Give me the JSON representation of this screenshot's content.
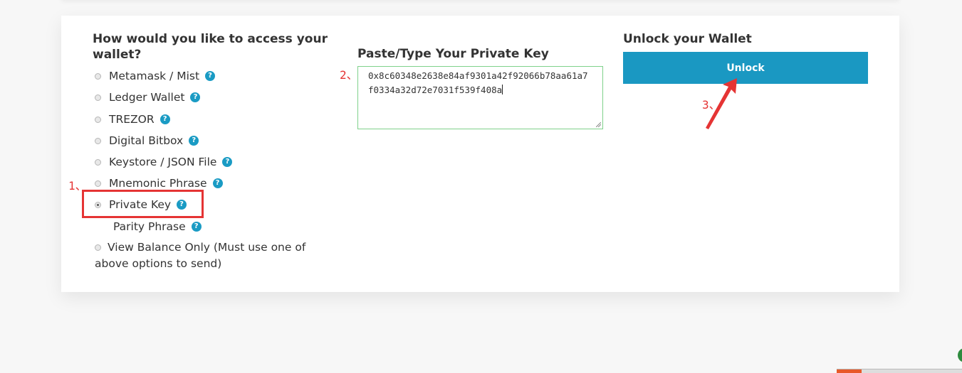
{
  "access": {
    "title": "How would you like to access your wallet?",
    "options": [
      {
        "label": "Metamask / Mist",
        "selected": false,
        "help": "?"
      },
      {
        "label": "Ledger Wallet",
        "selected": false,
        "help": "?"
      },
      {
        "label": "TREZOR",
        "selected": false,
        "help": "?"
      },
      {
        "label": "Digital Bitbox",
        "selected": false,
        "help": "?"
      },
      {
        "label": "Keystore / JSON File",
        "selected": false,
        "help": "?"
      },
      {
        "label": "Mnemonic Phrase",
        "selected": false,
        "help": "?"
      },
      {
        "label": "Private Key",
        "selected": true,
        "help": "?"
      },
      {
        "label": "Parity Phrase",
        "selected": false,
        "help": "?"
      },
      {
        "label": "View Balance Only (Must use one of above options to send)",
        "selected": false
      }
    ]
  },
  "private_key": {
    "title": "Paste/Type Your Private Key",
    "value": "0x8c60348e2638e84af9301a42f92066b78aa61a7f0334a32d72e7031f539f408a"
  },
  "unlock": {
    "title": "Unlock your Wallet",
    "button_label": "Unlock"
  },
  "annotations": {
    "step1": "1、",
    "step2": "2、",
    "step3": "3、",
    "color": "#e53434"
  },
  "colors": {
    "accent": "#1a98c2",
    "input_border": "#7fd18b"
  }
}
